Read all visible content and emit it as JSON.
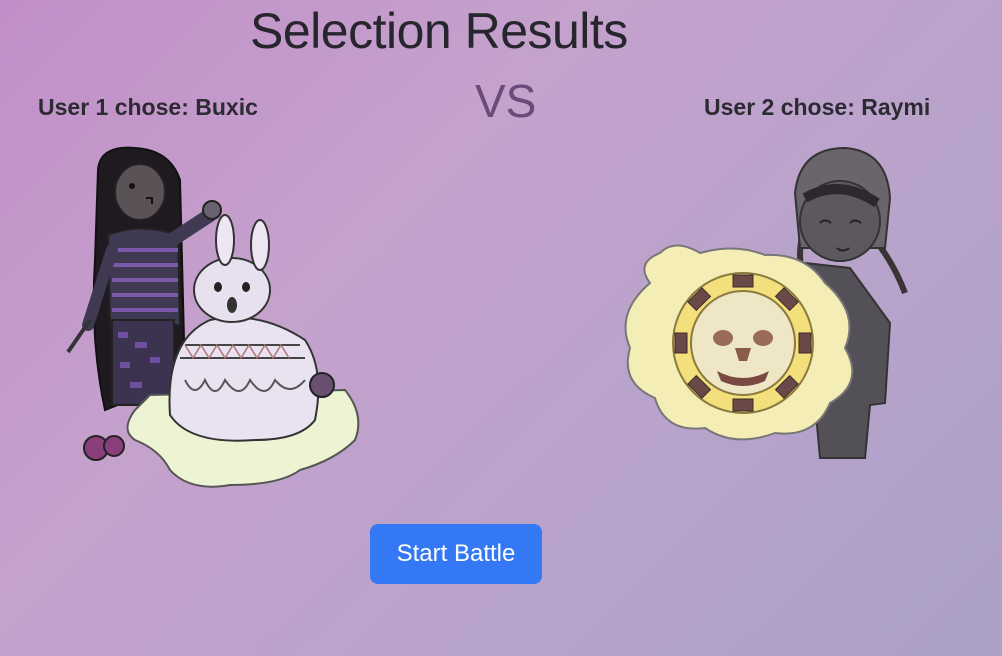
{
  "page": {
    "title": "Selection Results",
    "vs_text": "VS"
  },
  "players": [
    {
      "label": "User 1 chose: Buxic",
      "character_icon": "buxic-girl-with-bunny-drawing"
    },
    {
      "label": "User 2 chose: Raymi",
      "character_icon": "raymi-girl-with-sun-shield-drawing"
    }
  ],
  "actions": {
    "start_label": "Start Battle"
  },
  "colors": {
    "background_start": "#c28ec9",
    "background_end": "#aba0c6",
    "button": "#3478f6",
    "vs": "#6c4a7a"
  }
}
